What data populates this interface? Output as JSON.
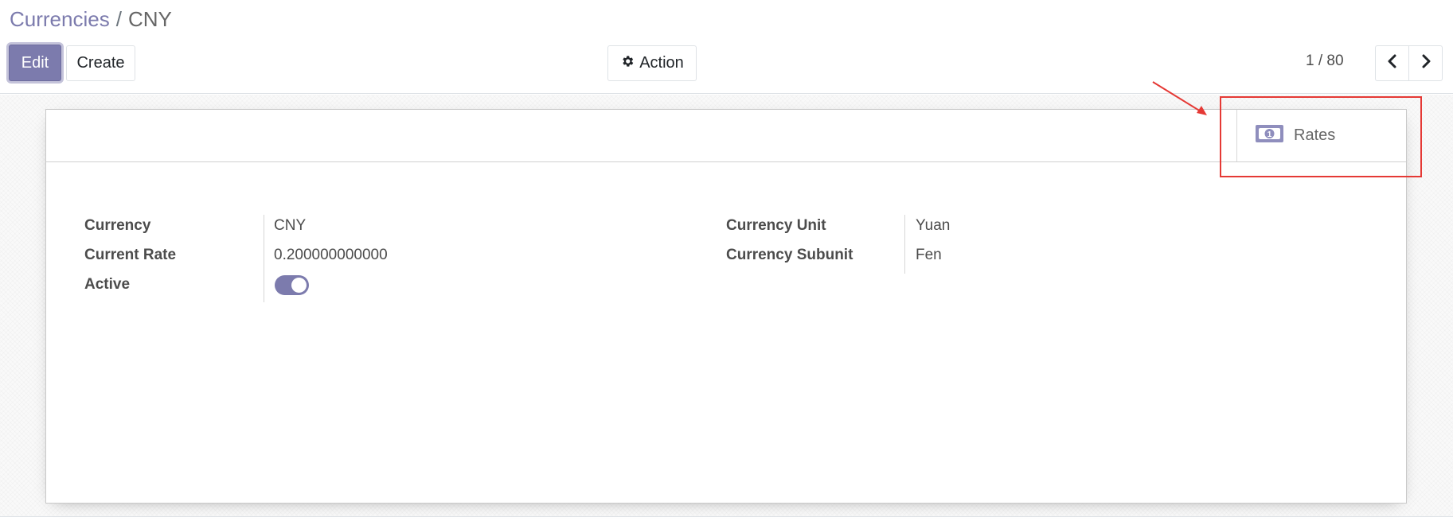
{
  "breadcrumb": {
    "parent": "Currencies",
    "separator": "/",
    "current": "CNY"
  },
  "toolbar": {
    "edit_label": "Edit",
    "create_label": "Create",
    "action_label": "Action",
    "action_icon": "gear-icon"
  },
  "pager": {
    "value": "1 / 80",
    "prev_icon": "chevron-left-icon",
    "next_icon": "chevron-right-icon"
  },
  "smart_buttons": {
    "rates_label": "Rates",
    "rates_icon": "money-icon"
  },
  "form": {
    "currency_label": "Currency",
    "currency_value": "CNY",
    "current_rate_label": "Current Rate",
    "current_rate_value": "0.200000000000",
    "active_label": "Active",
    "active_value": true,
    "currency_unit_label": "Currency Unit",
    "currency_unit_value": "Yuan",
    "currency_subunit_label": "Currency Subunit",
    "currency_subunit_value": "Fen"
  },
  "colors": {
    "primary": "#7c7bad",
    "annotation": "#e53935"
  }
}
